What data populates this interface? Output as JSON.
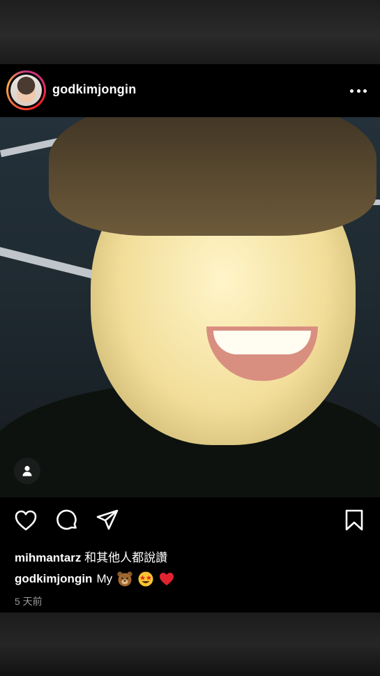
{
  "post": {
    "username": "godkimjongin",
    "more_icon": "more-horizontal-icon",
    "liked_by": {
      "user": "mihmantarz",
      "suffix": "和其他人都說讚"
    },
    "caption": {
      "user": "godkimjongin",
      "text": "My"
    },
    "emojis": [
      "bear-face-emoji",
      "star-struck-emoji",
      "red-heart-emoji"
    ],
    "timestamp": "5 天前"
  },
  "actions": {
    "like_icon": "heart-icon",
    "comment_icon": "comment-icon",
    "share_icon": "paper-plane-icon",
    "save_icon": "bookmark-icon"
  },
  "colors": {
    "background": "#000000",
    "text": "#ffffff",
    "muted": "#9a9a9a",
    "avatar_ring": "#e1306c"
  }
}
